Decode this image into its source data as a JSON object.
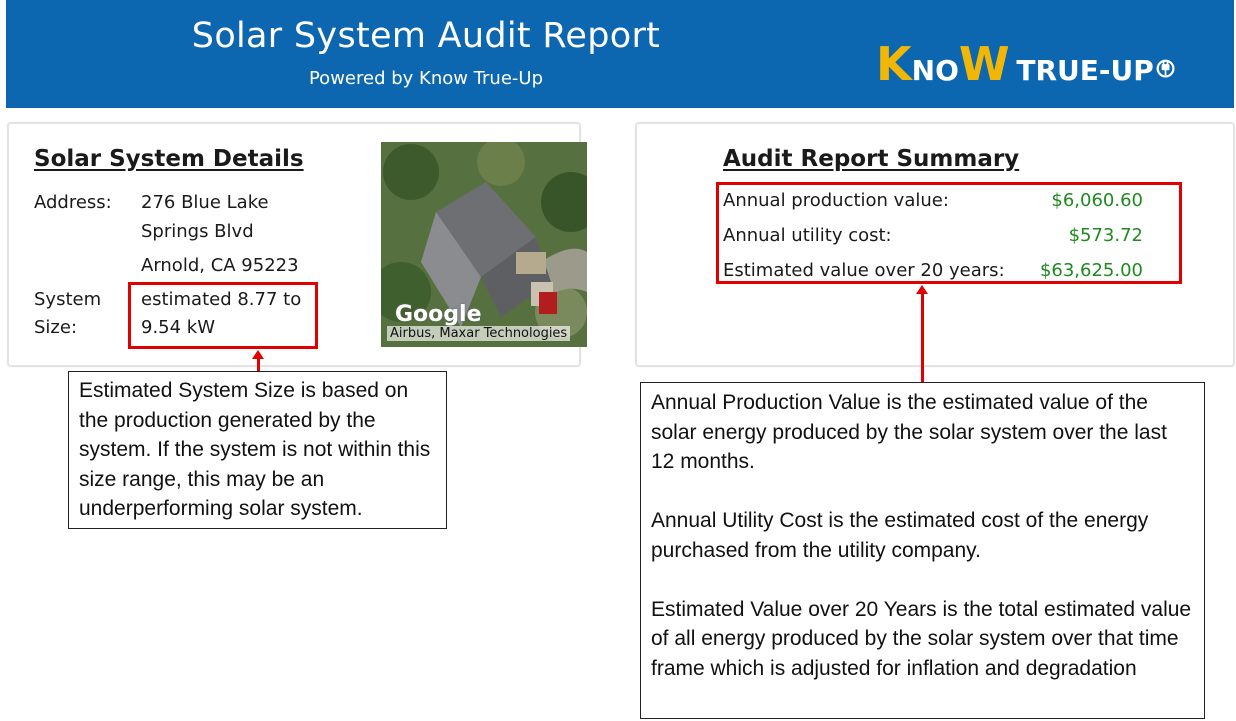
{
  "header": {
    "title": "Solar System Audit Report",
    "subtitle": "Powered by Know True-Up",
    "logo": {
      "part1": "K",
      "part2": "NO",
      "part3": "W",
      "part4": "TRUE-UP",
      "icon": "power-plug-icon",
      "accent_color": "#f2b705"
    },
    "background_color": "#0c67b0"
  },
  "details": {
    "heading": "Solar System Details",
    "address_label": "Address:",
    "address_line1": "276 Blue Lake Springs Blvd",
    "address_line2": "Arnold, CA 95223",
    "size_label": "System Size:",
    "size_value": "estimated 8.77 to 9.54 kW",
    "map_brand": "Google",
    "map_attribution": "Airbus, Maxar Technologies"
  },
  "summary": {
    "heading": "Audit Report Summary",
    "rows": [
      {
        "label": "Annual production value:",
        "value": "$6,060.60"
      },
      {
        "label": "Annual utility cost:",
        "value": "$573.72"
      },
      {
        "label": "Estimated value over 20 years:",
        "value": "$63,625.00"
      }
    ],
    "value_color": "#1f8a1f"
  },
  "callouts": {
    "size_note": "Estimated System Size is based on the production generated by the system. If the system is not within this size range, this may be an underperforming solar system.",
    "summary_note_1": "Annual Production Value is the estimated value of the solar energy produced by the solar system over the last 12 months.",
    "summary_note_2": "Annual Utility Cost is the estimated cost of the energy purchased from the utility company.",
    "summary_note_3": "Estimated Value over 20 Years is the total estimated value of all energy produced by the solar system over that time frame which is adjusted for inflation and degradation",
    "highlight_color": "#e00000"
  }
}
